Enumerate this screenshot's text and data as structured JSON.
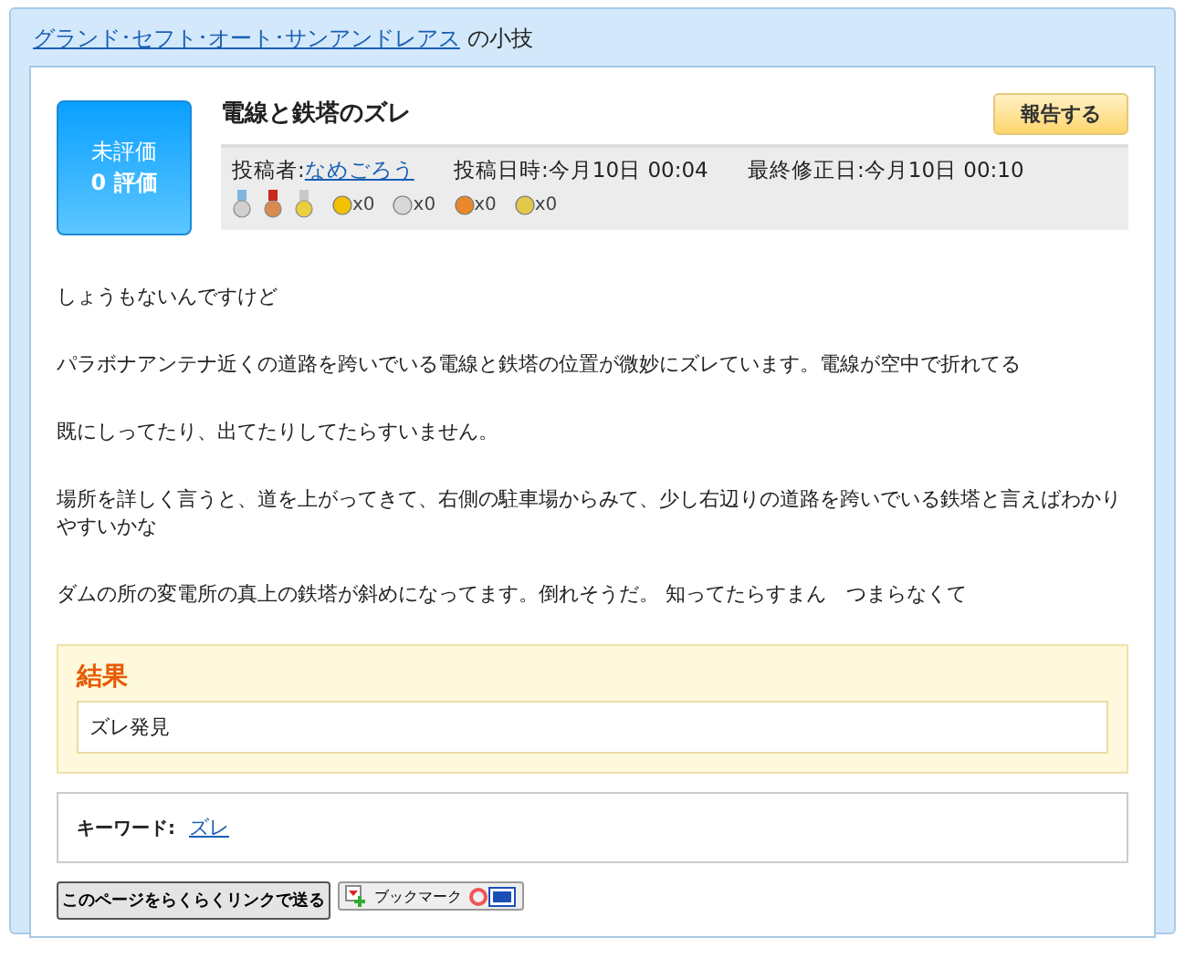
{
  "breadcrumb": {
    "link": "グランド･セフト･オート･サンアンドレアス",
    "suffix": "の小技"
  },
  "rating": {
    "status": "未評価",
    "count": "0 評価"
  },
  "title": "電線と鉄塔のズレ",
  "report_button": "報告する",
  "meta": {
    "poster_label": "投稿者:",
    "poster": "なめごろう",
    "posted_label": "投稿日時:",
    "posted": "今月10日 00:04",
    "modified_label": "最終修正日:",
    "modified": "今月10日 00:10"
  },
  "medals": [
    {
      "kind": "silver"
    },
    {
      "kind": "bronze"
    },
    {
      "kind": "gold"
    }
  ],
  "badges": [
    {
      "kind": "first",
      "count": "x0"
    },
    {
      "kind": "second",
      "count": "x0"
    },
    {
      "kind": "third",
      "count": "x0"
    },
    {
      "kind": "lambda",
      "count": "x0"
    }
  ],
  "body": [
    "しょうもないんですけど",
    "パラボナアンテナ近くの道路を跨いでいる電線と鉄塔の位置が微妙にズレています。電線が空中で折れてる",
    "既にしってたり、出てたりしてたらすいません。",
    "場所を詳しく言うと、道を上がってきて、右側の駐車場からみて、少し右辺りの道路を跨いでいる鉄塔と言えばわかりやすいかな",
    "ダムの所の変電所の真上の鉄塔が斜めになってます。倒れそうだ。 知ってたらすまん　つまらなくて"
  ],
  "result": {
    "heading": "結果",
    "text": "ズレ発見"
  },
  "keyword": {
    "label": "キーワード:",
    "value": "ズレ"
  },
  "send_button": "このページをらくらくリンクで送る",
  "bookmark_button": "ブックマーク"
}
